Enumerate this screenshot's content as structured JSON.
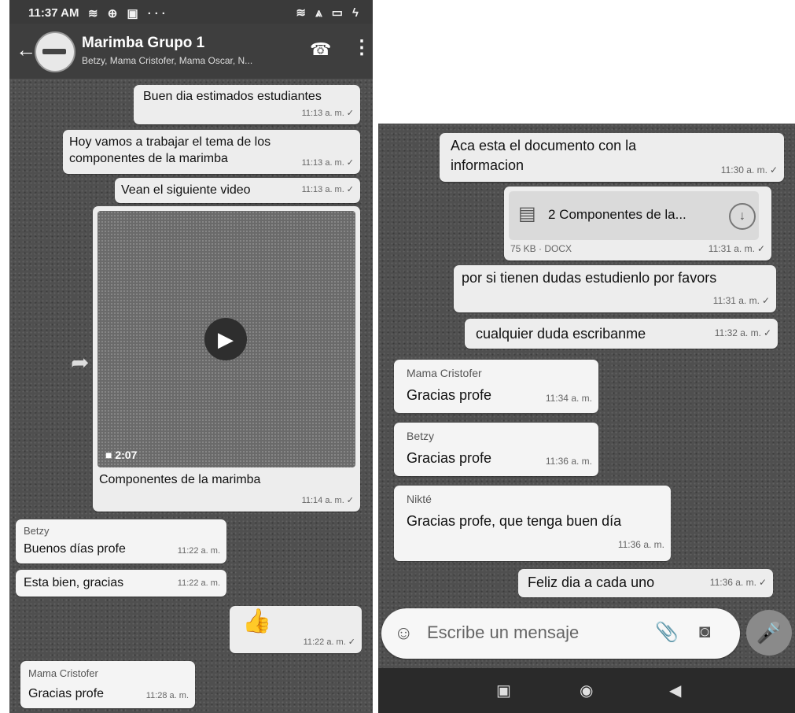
{
  "status": {
    "time": "11:37 AM",
    "left_icons": "≋ ⊕ ▣ ···",
    "right_icons": "≋ ⩓ ▭ ϟ"
  },
  "chat": {
    "title": "Marimba Grupo 1",
    "members": "Betzy, Mama Cristofer, Mama Oscar, N..."
  },
  "left_messages": {
    "m1": {
      "text": "Buen dia estimados estudiantes",
      "time": "11:13 a. m."
    },
    "m2": {
      "line1": "Hoy vamos a trabajar el tema de los",
      "line2": "componentes de la marimba",
      "time": "11:13 a. m."
    },
    "m3": {
      "text": "Vean el siguiente video",
      "time": "11:13 a. m."
    },
    "video": {
      "duration": "2:07",
      "caption": "Componentes de la marimba",
      "time": "11:14 a. m."
    },
    "m5": {
      "sender": "Betzy",
      "text": "Buenos días profe",
      "time": "11:22 a. m."
    },
    "m6": {
      "text": "Esta bien, gracias",
      "time": "11:22 a. m."
    },
    "m7": {
      "time": "11:22 a. m."
    },
    "m8": {
      "sender": "Mama Cristofer",
      "text": "Gracias profe",
      "time": "11:28 a. m."
    }
  },
  "right_messages": {
    "r1": {
      "line1": "Aca esta el documento con la",
      "line2": "informacion",
      "time": "11:30 a. m."
    },
    "doc": {
      "name": "2 Componentes de la...",
      "info": "75 KB · DOCX",
      "time": "11:31 a. m."
    },
    "r3": {
      "text": "por si tienen dudas estudienlo por favors",
      "time": "11:31 a. m."
    },
    "r4": {
      "text": "cualquier duda escribanme",
      "time": "11:32 a. m."
    },
    "r5": {
      "sender": "Mama Cristofer",
      "text": "Gracias profe",
      "time": "11:34 a. m."
    },
    "r6": {
      "sender": "Betzy",
      "text": "Gracias profe",
      "time": "11:36 a. m."
    },
    "r7": {
      "sender": "Nikté",
      "text": "Gracias profe, que tenga buen día",
      "time": "11:36 a. m."
    },
    "r8": {
      "text": "Feliz dia a cada uno",
      "time": "11:36 a. m."
    }
  },
  "composer": {
    "placeholder": "Escribe un mensaje"
  },
  "icons": {
    "back": "←",
    "call": "☎",
    "menu": "⋮",
    "play": "▶",
    "video_cam": "■",
    "forward": "➦",
    "thumbs_up": "👍",
    "check": "✓",
    "doc": "▤",
    "download": "↓",
    "emoji": "☺",
    "clip": "📎",
    "camera": "◙",
    "mic": "🎤",
    "nav_square": "▣",
    "nav_home": "◉",
    "nav_back": "◀"
  },
  "colors": {
    "chat_bg": "#4f4f4f",
    "bubble": "#f4f4f4",
    "header": "#3e3e3e"
  }
}
